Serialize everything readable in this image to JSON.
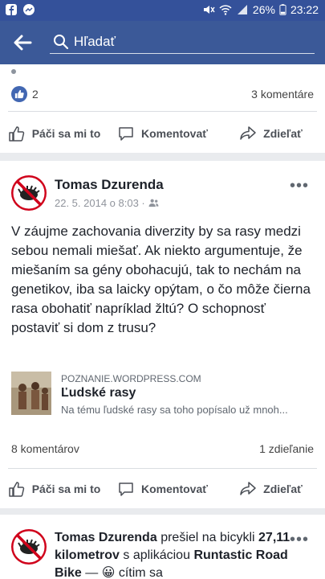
{
  "status_bar": {
    "battery": "26%",
    "time": "23:22"
  },
  "search": {
    "placeholder": "Hľadať"
  },
  "post1": {
    "like_count": "2",
    "comments": "3 komentáre"
  },
  "actions": {
    "like": "Páči sa mi to",
    "comment": "Komentovať",
    "share": "Zdieľať"
  },
  "post2": {
    "author": "Tomas Dzurenda",
    "date": "22. 5. 2014 o 8:03 ·",
    "text": "V záujme zachovania diverzity by sa rasy medzi sebou nemali miešať. Ak niekto argumentuje, že miešaním sa gény obohacujú, tak to nechám na genetikov, iba sa laicky opýtam, o čo môže čierna rasa obohatiť napríklad žltú? O schopnosť postaviť si dom z trusu?",
    "link_domain": "POZNANIE.WORDPRESS.COM",
    "link_title": "Ľudské rasy",
    "link_desc": "Na tému ľudské rasy sa toho popísalo už mnoh...",
    "comments": "8 komentárov",
    "shares": "1 zdieľanie"
  },
  "post3": {
    "author": "Tomas Dzurenda",
    "action": "prešiel na bicykli",
    "distance": "27,11 kilometrov",
    "with_app": "s aplikáciou",
    "app": "Runtastic Road Bike",
    "rest": "— 😀 cítim sa"
  },
  "colors": {
    "brand": "#3b5998",
    "like": "#4267b2"
  }
}
